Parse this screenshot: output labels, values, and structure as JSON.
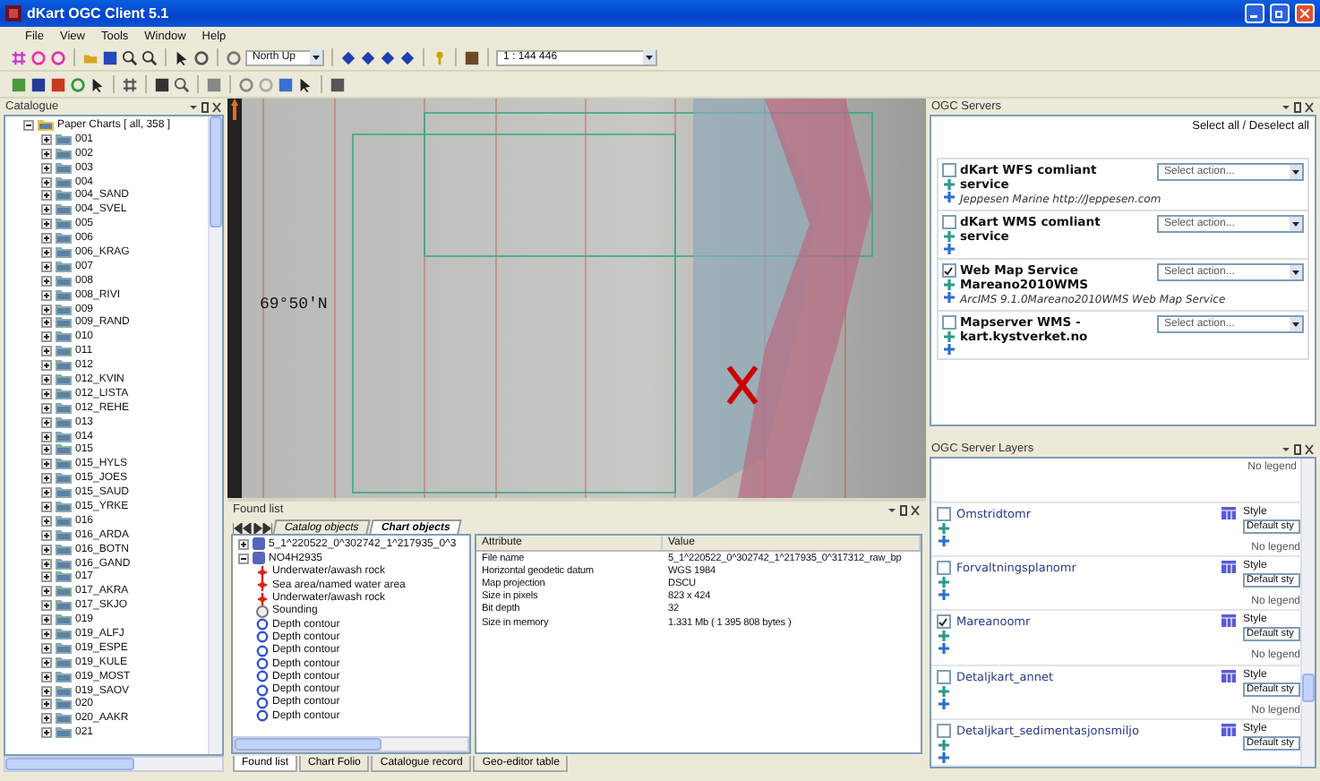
{
  "window": {
    "title": "dKart OGC Client 5.1"
  },
  "menu": [
    "File",
    "View",
    "Tools",
    "Window",
    "Help"
  ],
  "toolbar": {
    "orientation": "North Up",
    "scale": "1 : 144 446"
  },
  "catalogue": {
    "title": "Catalogue",
    "root": {
      "label": "Paper Charts [ all, 358 ]",
      "expanded": true,
      "children": [
        {
          "label": "001"
        },
        {
          "label": "002"
        },
        {
          "label": "003"
        },
        {
          "label": "004"
        },
        {
          "label": "004_SAND"
        },
        {
          "label": "004_SVEL"
        },
        {
          "label": "005"
        },
        {
          "label": "006"
        },
        {
          "label": "006_KRAG"
        },
        {
          "label": "007"
        },
        {
          "label": "008"
        },
        {
          "label": "008_RIVI"
        },
        {
          "label": "009"
        },
        {
          "label": "009_RAND"
        },
        {
          "label": "010"
        },
        {
          "label": "011"
        },
        {
          "label": "012"
        },
        {
          "label": "012_KVIN"
        },
        {
          "label": "012_LISTA"
        },
        {
          "label": "012_REHE"
        },
        {
          "label": "013"
        },
        {
          "label": "014"
        },
        {
          "label": "015"
        },
        {
          "label": "015_HYLS"
        },
        {
          "label": "015_JOES"
        },
        {
          "label": "015_SAUD"
        },
        {
          "label": "015_YRKE"
        },
        {
          "label": "016"
        },
        {
          "label": "016_ARDA"
        },
        {
          "label": "016_BOTN"
        },
        {
          "label": "016_GAND"
        },
        {
          "label": "017"
        },
        {
          "label": "017_AKRA"
        },
        {
          "label": "017_SKJO"
        },
        {
          "label": "019"
        },
        {
          "label": "019_ALFJ"
        },
        {
          "label": "019_ESPE"
        },
        {
          "label": "019_KULE"
        },
        {
          "label": "019_MOST"
        },
        {
          "label": "019_SAOV"
        },
        {
          "label": "020"
        },
        {
          "label": "020_AAKR"
        },
        {
          "label": "021"
        }
      ]
    }
  },
  "map": {
    "latitude_label": "69°50'N"
  },
  "found_list": {
    "title": "Found list",
    "tabs": [
      {
        "label": "Catalog objects",
        "selected": false
      },
      {
        "label": "Chart objects",
        "selected": true
      }
    ],
    "tree": [
      {
        "label": "5_1^220522_0^302742_1^217935_0^3",
        "expanded": false
      },
      {
        "label": "NO4H2935",
        "expanded": true,
        "children": [
          {
            "label": "Underwater/awash rock",
            "kind": "point"
          },
          {
            "label": "Sea area/named water area",
            "kind": "point"
          },
          {
            "label": "Underwater/awash rock",
            "kind": "point"
          },
          {
            "label": "Sounding",
            "kind": "sounding"
          },
          {
            "label": "Depth contour",
            "kind": "contour"
          },
          {
            "label": "Depth contour",
            "kind": "contour"
          },
          {
            "label": "Depth contour",
            "kind": "contour"
          },
          {
            "label": "Depth contour",
            "kind": "contour"
          },
          {
            "label": "Depth contour",
            "kind": "contour"
          },
          {
            "label": "Depth contour",
            "kind": "contour"
          },
          {
            "label": "Depth contour",
            "kind": "contour"
          },
          {
            "label": "Depth contour",
            "kind": "contour"
          }
        ]
      }
    ],
    "table": {
      "columns": [
        "Attribute",
        "Value"
      ],
      "rows": [
        [
          "File name",
          "5_1^220522_0^302742_1^217935_0^317312_raw_bp"
        ],
        [
          "Horizontal geodetic datum",
          "WGS 1984"
        ],
        [
          "Map projection",
          "DSCU"
        ],
        [
          "Size in pixels",
          "823 x 424"
        ],
        [
          "Bit depth",
          "32"
        ],
        [
          "Size in memory",
          "1.331 Mb ( 1 395 808 bytes )"
        ]
      ]
    },
    "bottom_tabs": [
      {
        "label": "Found list",
        "selected": true
      },
      {
        "label": "Chart Folio",
        "selected": false
      },
      {
        "label": "Catalogue record",
        "selected": false
      },
      {
        "label": "Geo-editor table",
        "selected": false
      }
    ]
  },
  "servers": {
    "title": "OGC Servers",
    "select_all": "Select all / Deselect all",
    "items": [
      {
        "name": "dKart WFS comliant service",
        "description": "Jeppesen Marine http://Jeppesen.com",
        "checked": false,
        "action": "Select action..."
      },
      {
        "name": "dKart WMS comliant service",
        "checked": false,
        "action": "Select action..."
      },
      {
        "name": "Web Map Service Mareano2010WMS",
        "description": "ArcIMS 9.1.0Mareano2010WMS Web Map Service",
        "checked": true,
        "action": "Select action..."
      },
      {
        "name": "Mapserver WMS - kart.kystverket.no",
        "checked": false,
        "action": "Select action..."
      }
    ]
  },
  "layers": {
    "title": "OGC Server Layers",
    "partial_legend": "No legend",
    "items": [
      {
        "name": "Omstridtomr",
        "checked": false,
        "style_label": "Style",
        "style": "Default sty",
        "legend": "No legend"
      },
      {
        "name": "Forvaltningsplanomr",
        "checked": false,
        "style_label": "Style",
        "style": "Default sty",
        "legend": "No legend"
      },
      {
        "name": "Mareanoomr",
        "checked": true,
        "style_label": "Style",
        "style": "Default sty",
        "legend": "No legend"
      },
      {
        "name": "Detaljkart_annet",
        "checked": false,
        "style_label": "Style",
        "style": "Default sty",
        "legend": "No legend"
      },
      {
        "name": "Detaljkart_sedimentasjonsmiljo",
        "checked": false,
        "style_label": "Style",
        "style": "Default sty"
      }
    ]
  }
}
